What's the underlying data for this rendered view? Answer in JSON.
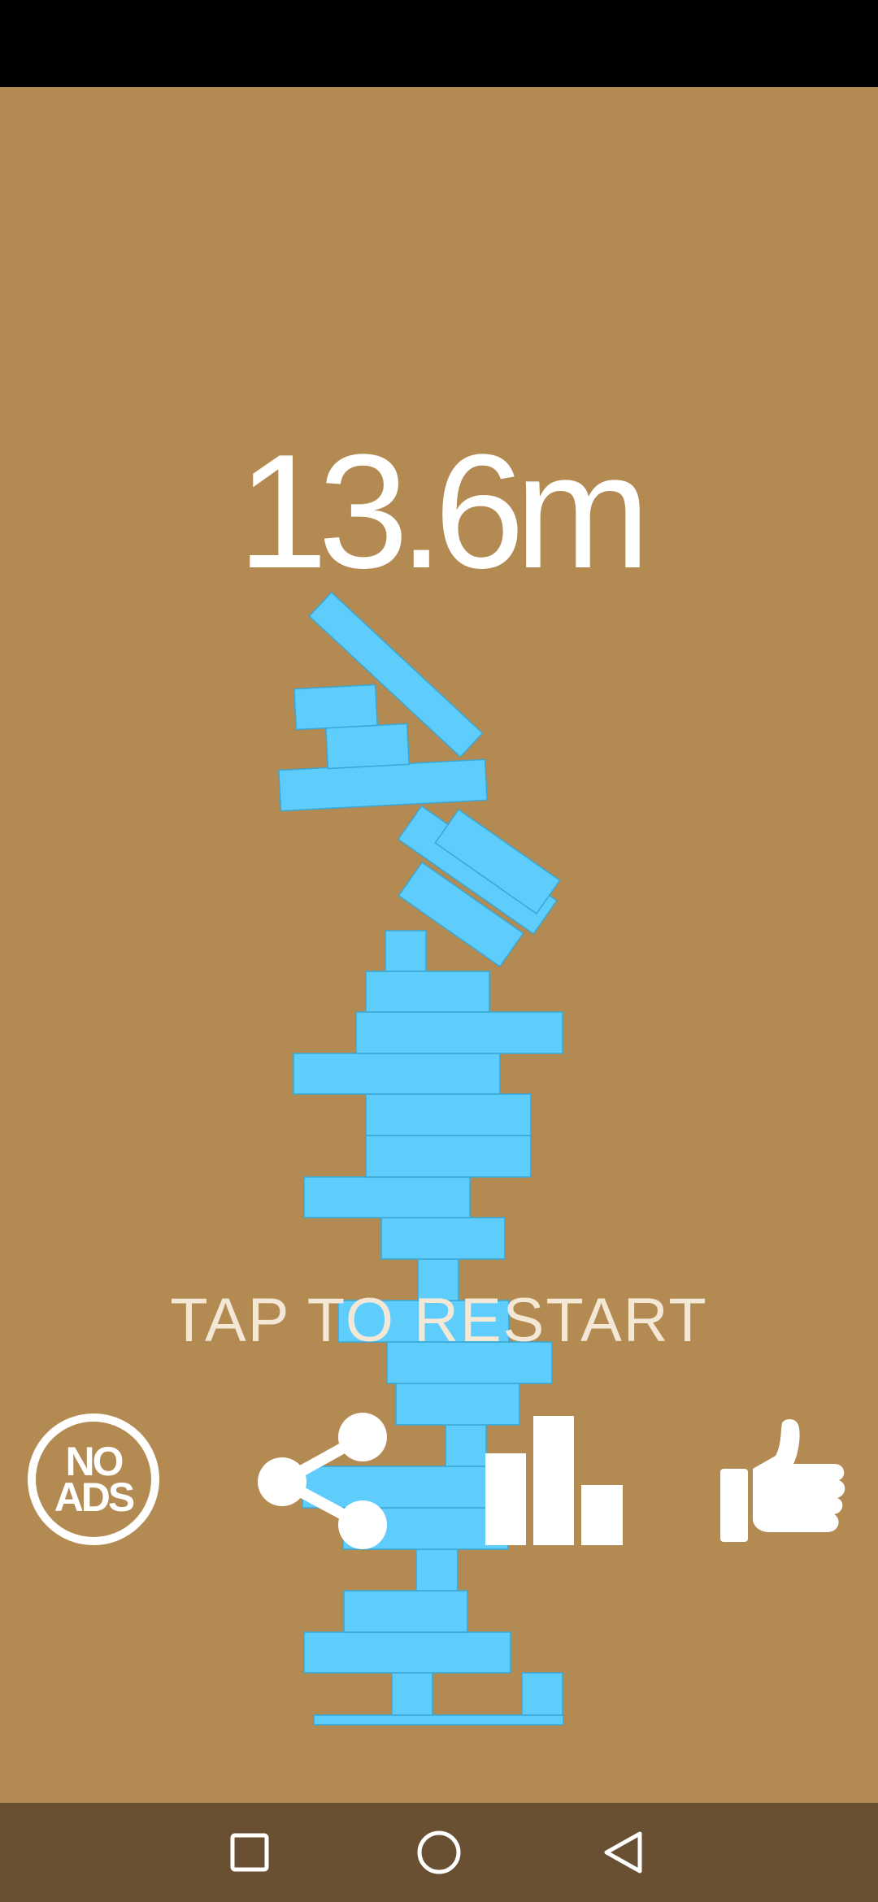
{
  "game": {
    "score": "13.6m",
    "restart_prompt": "TAP TO RESTART",
    "block_color": "#5fcdfc",
    "background_color": "#b38a52"
  },
  "buttons": {
    "no_ads": {
      "line1": "NO",
      "line2": "ADS",
      "icon": "no-ads-icon"
    },
    "share": {
      "icon": "share-icon"
    },
    "leaderboard": {
      "icon": "bar-chart-icon"
    },
    "like": {
      "icon": "thumbs-up-icon"
    }
  },
  "navigation": {
    "recents": "square-icon",
    "home": "circle-icon",
    "back": "triangle-back-icon"
  }
}
